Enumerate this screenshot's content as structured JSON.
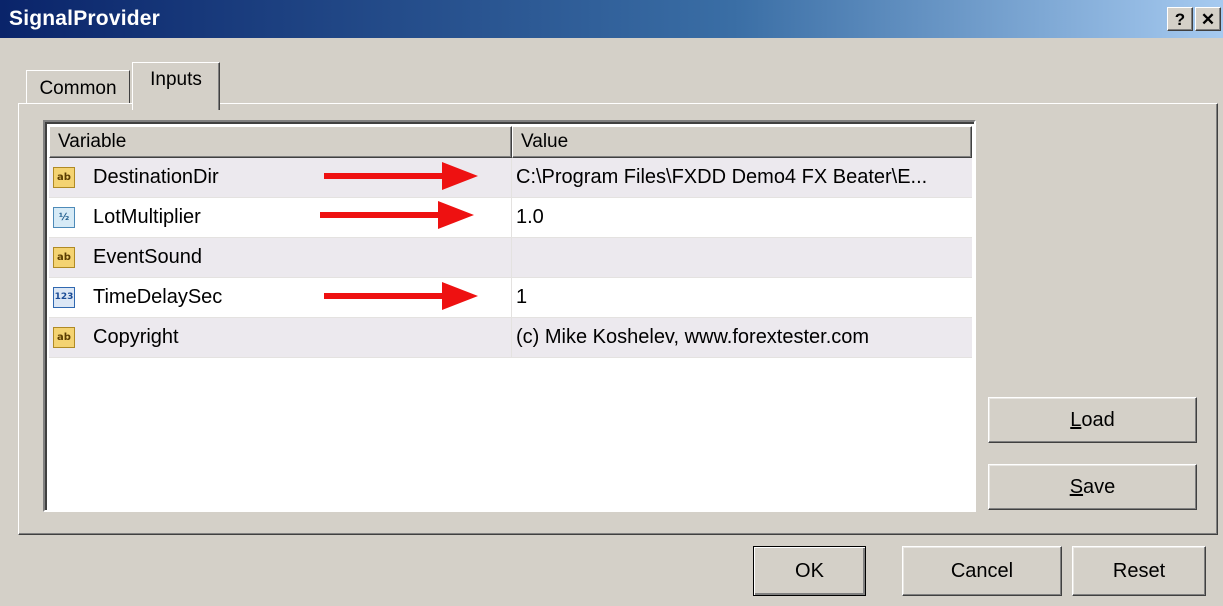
{
  "window": {
    "title": "SignalProvider",
    "help_label": "?",
    "close_label": "✕"
  },
  "tabs": [
    {
      "label": "Common",
      "active": false
    },
    {
      "label": "Inputs",
      "active": true
    }
  ],
  "table": {
    "columns": [
      "Variable",
      "Value"
    ],
    "rows": [
      {
        "icon": "ab",
        "icon_name": "string-type-icon",
        "variable": "DestinationDir",
        "value": "C:\\Program Files\\FXDD Demo4 FX Beater\\E...",
        "arrow": true
      },
      {
        "icon": "½",
        "icon_name": "double-type-icon",
        "variable": "LotMultiplier",
        "value": "1.0",
        "arrow": true
      },
      {
        "icon": "ab",
        "icon_name": "string-type-icon",
        "variable": "EventSound",
        "value": "",
        "arrow": false
      },
      {
        "icon": "123",
        "icon_name": "integer-type-icon",
        "variable": "TimeDelaySec",
        "value": "1",
        "arrow": true
      },
      {
        "icon": "ab",
        "icon_name": "string-type-icon",
        "variable": "Copyright",
        "value": "(c) Mike Koshelev, www.forextester.com",
        "arrow": false
      }
    ]
  },
  "side_buttons": {
    "load_label": "L",
    "load_rest": "oad",
    "save_label": "S",
    "save_rest": "ave"
  },
  "footer_buttons": {
    "ok_label": "OK",
    "cancel_label": "Cancel",
    "reset_label": "Reset"
  },
  "colors": {
    "title_bar": "#0a246a",
    "dialog_face": "#d4d0c8",
    "row_shade": "#ece9ee",
    "annotation_arrow": "#ee1111"
  }
}
